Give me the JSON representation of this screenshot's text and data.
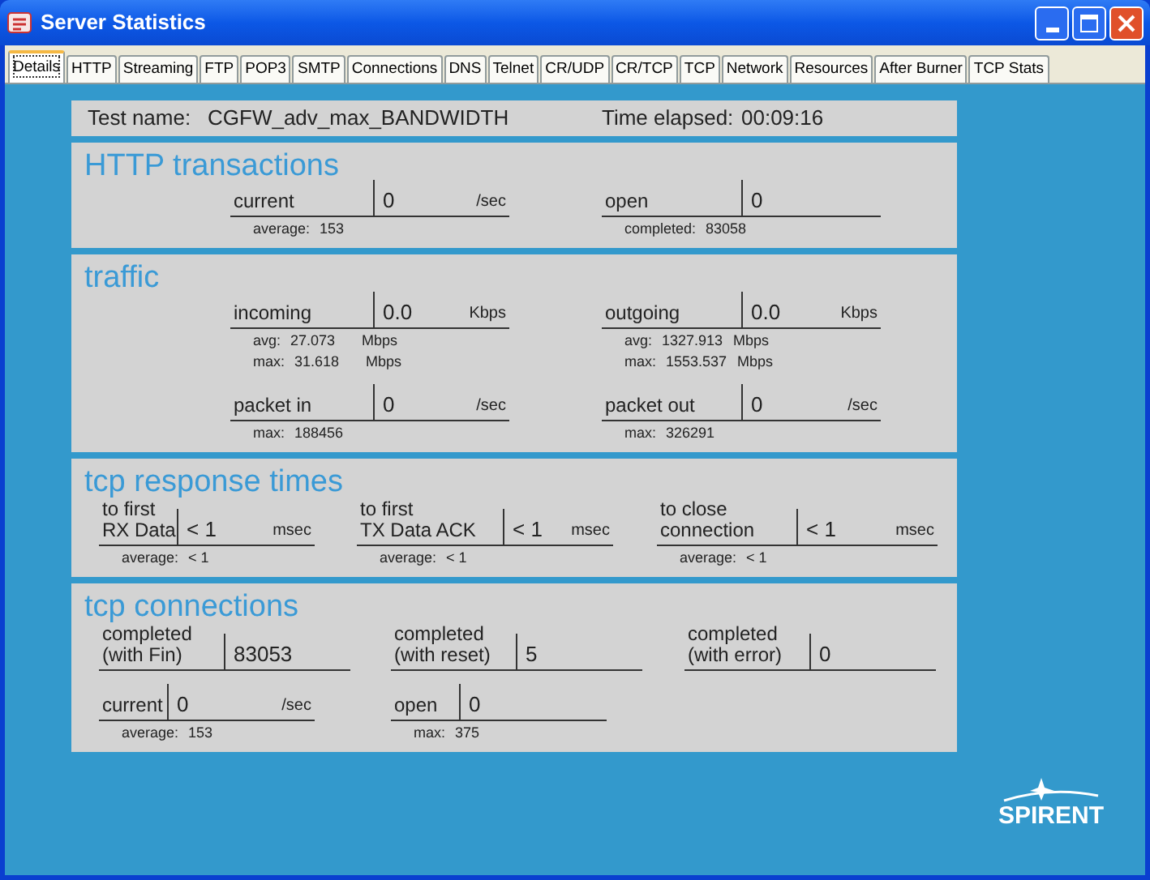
{
  "window": {
    "title": "Server Statistics"
  },
  "tabs": [
    {
      "label": "Details",
      "selected": true
    },
    {
      "label": "HTTP",
      "selected": false
    },
    {
      "label": "Streaming",
      "selected": false
    },
    {
      "label": "FTP",
      "selected": false
    },
    {
      "label": "POP3",
      "selected": false
    },
    {
      "label": "SMTP",
      "selected": false
    },
    {
      "label": "Connections",
      "selected": false
    },
    {
      "label": "DNS",
      "selected": false
    },
    {
      "label": "Telnet",
      "selected": false
    },
    {
      "label": "CR/UDP",
      "selected": false
    },
    {
      "label": "CR/TCP",
      "selected": false
    },
    {
      "label": "TCP",
      "selected": false
    },
    {
      "label": "Network",
      "selected": false
    },
    {
      "label": "Resources",
      "selected": false
    },
    {
      "label": "After Burner",
      "selected": false
    },
    {
      "label": "TCP Stats",
      "selected": false
    }
  ],
  "test_info": {
    "name_label": "Test name:",
    "name_value": "CGFW_adv_max_BANDWIDTH",
    "time_label": "Time elapsed:",
    "time_value": "00:09:16"
  },
  "sections": [
    {
      "kind": "wide",
      "title": "HTTP transactions",
      "rows": [
        [
          {
            "label": "current",
            "value": "0",
            "unit": "/sec",
            "stats": [
              {
                "label": "average:",
                "value": "153"
              }
            ]
          },
          {
            "label": "open",
            "value": "0",
            "stats": [
              {
                "label": "completed:",
                "value": "83058"
              }
            ]
          }
        ]
      ]
    },
    {
      "kind": "wide",
      "title": "traffic",
      "rows": [
        [
          {
            "label": "incoming",
            "value": "0.0",
            "unit": "Kbps",
            "stats": [
              {
                "label": "avg:",
                "value": "27.073",
                "unit": "Mbps"
              },
              {
                "label": "max:",
                "value": "31.618",
                "unit": "Mbps"
              }
            ]
          },
          {
            "label": "outgoing",
            "value": "0.0",
            "unit": "Kbps",
            "stats": [
              {
                "label": "avg:",
                "value": "1327.913",
                "unit": "Mbps"
              },
              {
                "label": "max:",
                "value": "1553.537",
                "unit": "Mbps"
              }
            ]
          }
        ],
        [
          {
            "label": "packet in",
            "value": "0",
            "unit": "/sec",
            "stats": [
              {
                "label": "max:",
                "value": "188456"
              }
            ]
          },
          {
            "label": "packet out",
            "value": "0",
            "unit": "/sec",
            "stats": [
              {
                "label": "max:",
                "value": "326291"
              }
            ]
          }
        ]
      ]
    },
    {
      "kind": "response",
      "title": "tcp response times",
      "rows": [
        [
          {
            "label": "to first\nRX Data",
            "value": "< 1",
            "unit": "msec",
            "stats": [
              {
                "label": "average:",
                "value": "< 1"
              }
            ]
          },
          {
            "label": "to first\nTX Data ACK",
            "value": "< 1",
            "unit": "msec",
            "stats": [
              {
                "label": "average:",
                "value": "< 1"
              }
            ]
          },
          {
            "label": "to close\nconnection",
            "value": "< 1",
            "unit": "msec",
            "stats": [
              {
                "label": "average:",
                "value": "< 1"
              }
            ]
          }
        ]
      ]
    },
    {
      "kind": "connections",
      "title": "tcp connections",
      "rows": [
        [
          {
            "label": "completed\n(with Fin)",
            "value": "83053"
          },
          {
            "label": "completed\n(with reset)",
            "value": "5"
          },
          {
            "label": "completed\n(with error)",
            "value": "0"
          }
        ],
        [
          {
            "label": "current",
            "value": "0",
            "unit": "/sec",
            "stats": [
              {
                "label": "average:",
                "value": "153"
              }
            ]
          },
          {
            "label": "open",
            "value": "0",
            "stats": [
              {
                "label": "max:",
                "value": "375"
              }
            ]
          }
        ]
      ]
    }
  ],
  "logo": {
    "text": "SPIRENT"
  }
}
